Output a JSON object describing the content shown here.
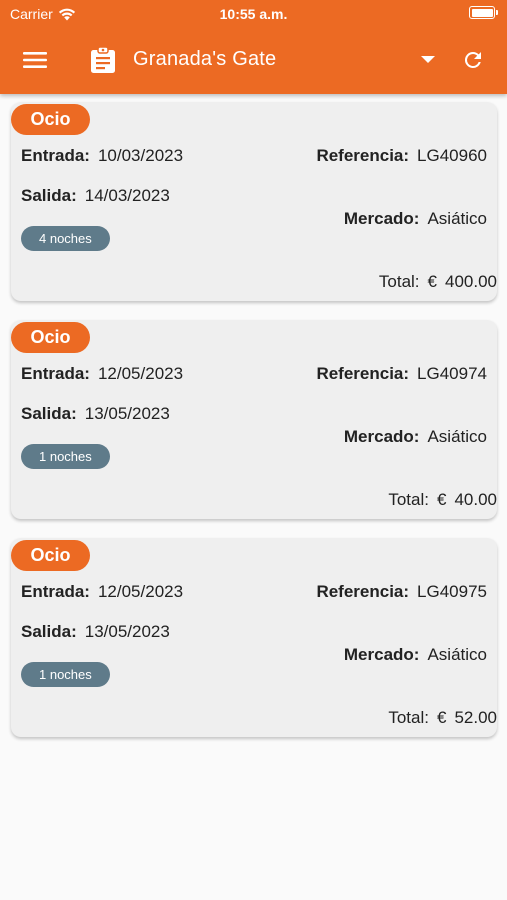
{
  "status_bar": {
    "carrier": "Carrier",
    "time": "10:55 a.m."
  },
  "app_bar": {
    "title": "Granada's Gate",
    "menu_icon": "menu-icon",
    "title_icon": "clipboard-icon",
    "dropdown_icon": "arrow-drop-down-icon",
    "refresh_icon": "refresh-icon"
  },
  "colors": {
    "accent": "#ec6a23",
    "nights_badge": "#5f7b8a",
    "card_bg": "#efefef"
  },
  "labels": {
    "entrada": "Entrada:",
    "salida": "Salida:",
    "referencia": "Referencia:",
    "mercado": "Mercado:",
    "total": "Total:",
    "currency": "€"
  },
  "bookings": [
    {
      "tag": "Ocio",
      "entrada": "10/03/2023",
      "salida": "14/03/2023",
      "referencia": "LG40960",
      "mercado": "Asiático",
      "noches": "4 noches",
      "total": "400.00"
    },
    {
      "tag": "Ocio",
      "entrada": "12/05/2023",
      "salida": "13/05/2023",
      "referencia": "LG40974",
      "mercado": "Asiático",
      "noches": "1 noches",
      "total": "40.00"
    },
    {
      "tag": "Ocio",
      "entrada": "12/05/2023",
      "salida": "13/05/2023",
      "referencia": "LG40975",
      "mercado": "Asiático",
      "noches": "1 noches",
      "total": "52.00"
    }
  ]
}
